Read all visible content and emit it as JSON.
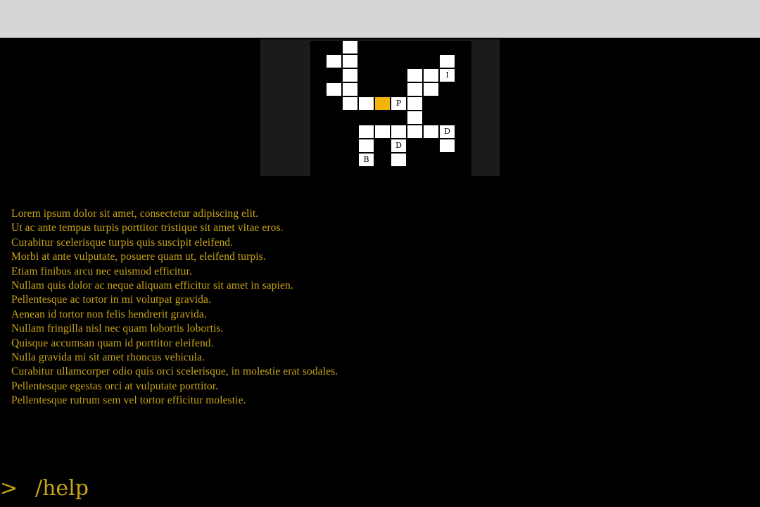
{
  "window": {
    "topbar_color": "#d6d6d6"
  },
  "minimap": {
    "frame_color": "#1b1b1b",
    "floor_color": "#ffffff",
    "player_color": "#f5b40a",
    "labels": {
      "item": "I",
      "player": "P",
      "door_east": "D",
      "door_south": "D",
      "boss": "B"
    }
  },
  "log": {
    "text_color": "#c8a414",
    "lines": [
      "Lorem ipsum dolor sit amet, consectetur adipiscing elit.",
      "Ut ac ante tempus turpis porttitor tristique sit amet vitae eros.",
      "Curabitur scelerisque turpis quis suscipit eleifend.",
      "Morbi at ante vulputate, posuere quam ut, eleifend turpis.",
      "Etiam finibus arcu nec euismod efficitur.",
      "Nullam quis dolor ac neque aliquam efficitur sit amet in sapien.",
      "Pellentesque ac tortor in mi volutpat gravida.",
      "Aenean id tortor non felis hendrerit gravida.",
      "Nullam fringilla nisl nec quam lobortis lobortis.",
      "Quisque accumsan quam id porttitor eleifend.",
      "Nulla gravida mi sit amet rhoncus vehicula.",
      "Curabitur ullamcorper odio quis orci scelerisque, in molestie erat sodales.",
      "Pellentesque egestas orci at vulputate porttitor.",
      "Pellentesque rutrum sem vel tortor efficitur molestie."
    ]
  },
  "prompt": {
    "symbol": ">",
    "value": "/help"
  }
}
